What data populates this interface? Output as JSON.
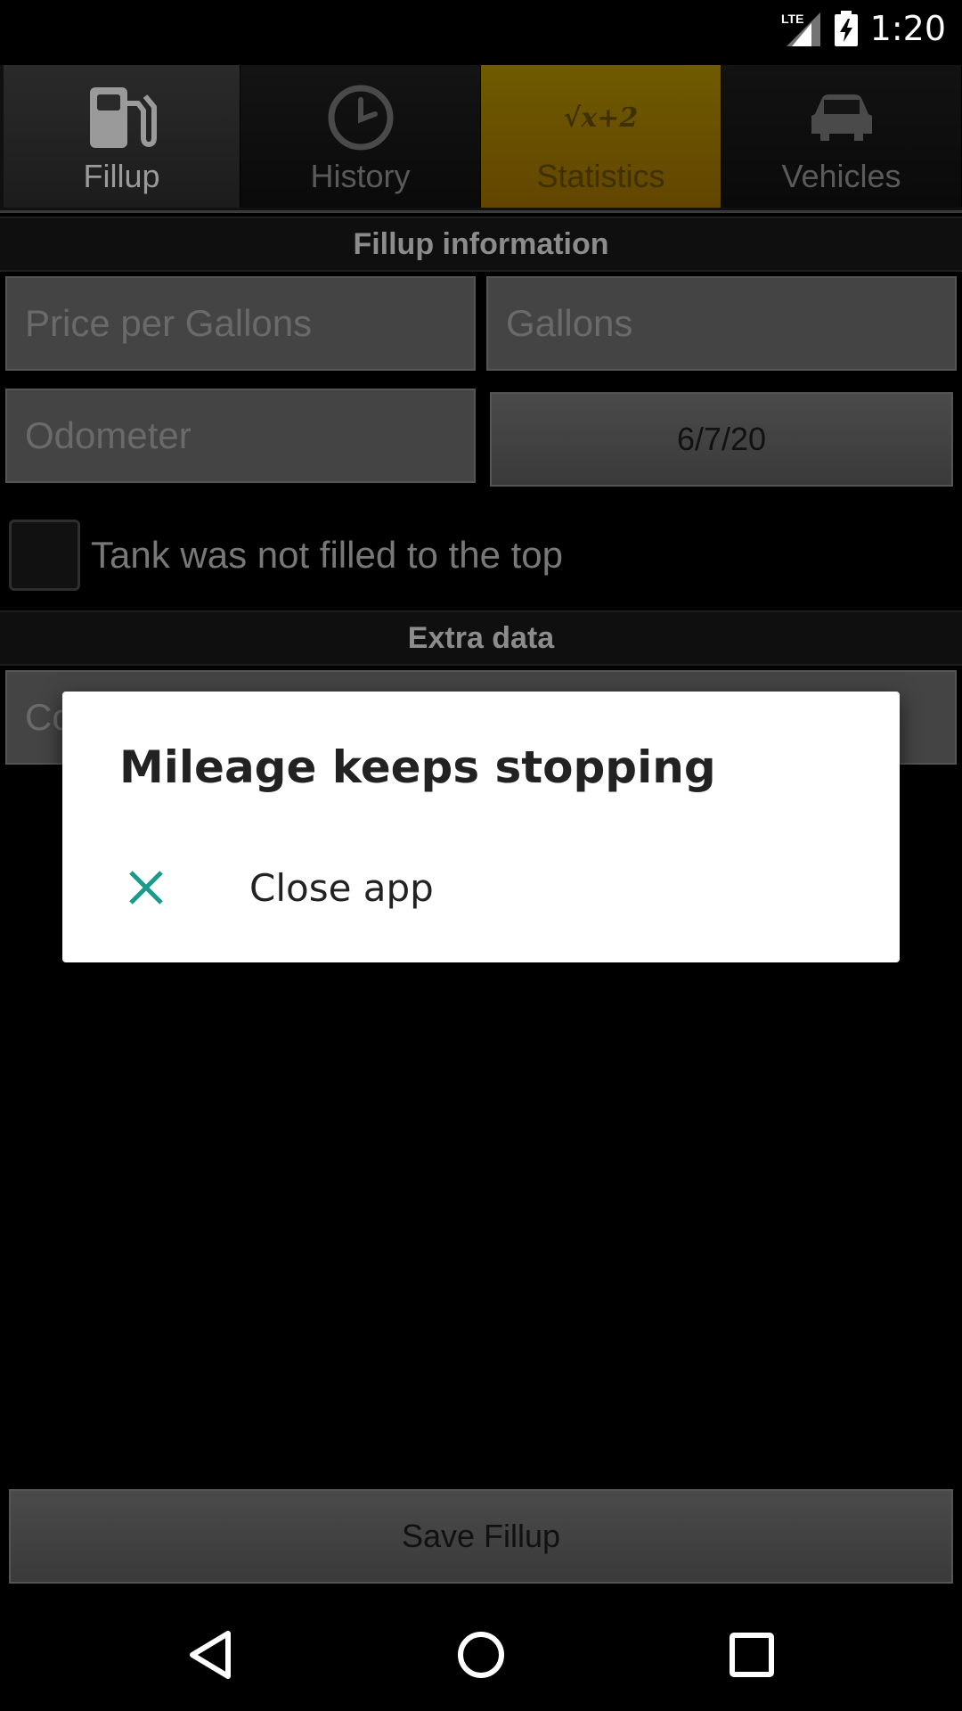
{
  "status_bar": {
    "network": "LTE",
    "time": "1:20"
  },
  "tabs": [
    {
      "label": "Fillup",
      "icon": "fuel-pump-icon"
    },
    {
      "label": "History",
      "icon": "clock-icon"
    },
    {
      "label": "Statistics",
      "icon": "sqrt-formula-icon",
      "icon_text": "√x+2"
    },
    {
      "label": "Vehicles",
      "icon": "car-icon"
    }
  ],
  "fillup_section": {
    "header": "Fillup information",
    "price_placeholder": "Price per Gallons",
    "gallons_placeholder": "Gallons",
    "odometer_placeholder": "Odometer",
    "date_value": "6/7/20",
    "partial_fill_label": "Tank was not filled to the top",
    "partial_fill_checked": false
  },
  "extra_section": {
    "header": "Extra data",
    "comment_placeholder_visible": "Co"
  },
  "save_button_label": "Save Fillup",
  "dialog": {
    "title": "Mileage keeps stopping",
    "action_label": "Close app",
    "action_icon": "close-icon",
    "accent_color": "#1a9a8a"
  },
  "colors": {
    "statistics_tab_bg": "#6f5a00"
  }
}
